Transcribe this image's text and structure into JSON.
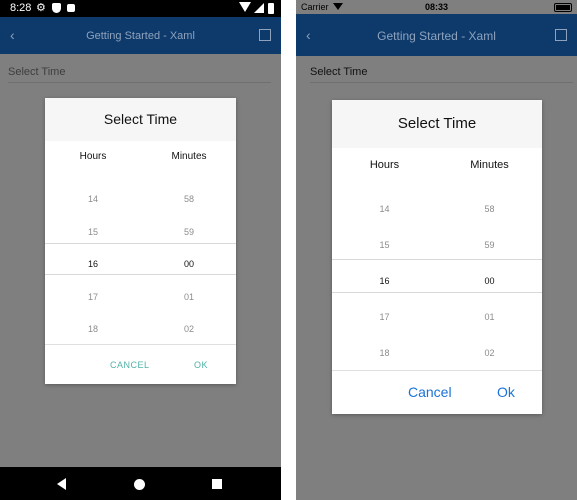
{
  "android": {
    "status_time": "8:28",
    "app_title": "Getting Started - Xaml",
    "field_placeholder": "Select Time",
    "dialog_title": "Select Time",
    "col_hours": "Hours",
    "col_minutes": "Minutes",
    "hours": [
      "14",
      "15",
      "16",
      "17",
      "18"
    ],
    "minutes": [
      "58",
      "59",
      "00",
      "01",
      "02"
    ],
    "cancel_label": "CANCEL",
    "ok_label": "OK"
  },
  "ios": {
    "carrier": "Carrier",
    "status_time": "08:33",
    "app_title": "Getting Started - Xaml",
    "field_placeholder": "Select Time",
    "dialog_title": "Select Time",
    "col_hours": "Hours",
    "col_minutes": "Minutes",
    "hours": [
      "14",
      "15",
      "16",
      "17",
      "18"
    ],
    "minutes": [
      "58",
      "59",
      "00",
      "01",
      "02"
    ],
    "cancel_label": "Cancel",
    "ok_label": "Ok"
  },
  "colors": {
    "appbar": "#0d3a6b",
    "android_accent": "#4fb3a6",
    "ios_accent": "#1a73d9",
    "overlay": "#7f7f7f"
  },
  "icons": [
    "gear-icon",
    "shield-icon",
    "lock-icon",
    "wifi-icon",
    "signal-icon",
    "battery-icon",
    "back-arrow-icon",
    "external-link-icon",
    "nav-back-icon",
    "nav-home-icon",
    "nav-recent-icon"
  ]
}
